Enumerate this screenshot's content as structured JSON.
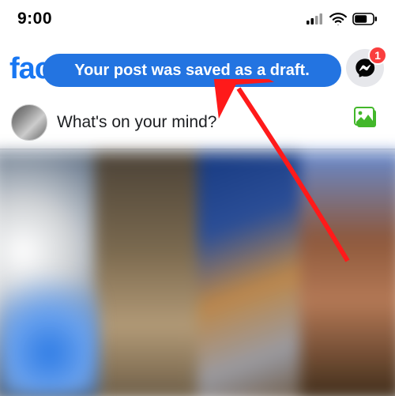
{
  "statusbar": {
    "time": "9:00"
  },
  "header": {
    "logo_text": "facebook"
  },
  "messenger": {
    "badge_count": "1"
  },
  "toast": {
    "message": "Your post was saved as a draft."
  },
  "composer": {
    "placeholder": "What's on your mind?"
  }
}
